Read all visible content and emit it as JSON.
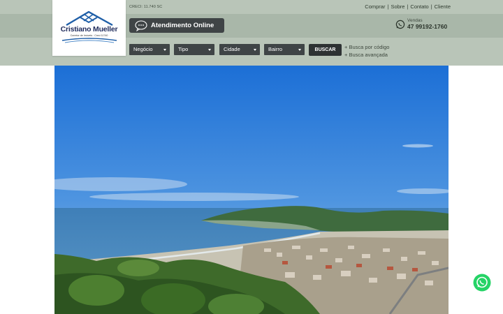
{
  "header": {
    "creci": "CRECI: 11.740 SC",
    "links": [
      "Comprar",
      "Sobre",
      "Contato",
      "Cliente"
    ],
    "online_label": "Atendimento Online",
    "sales_label": "Vendas",
    "sales_phone": "47 99192-1760"
  },
  "logo": {
    "name": "Cristiano Mueller",
    "subtitle": "Corretor de Imóveis · Creci 11740"
  },
  "search": {
    "selects": [
      "Negócio",
      "Tipo",
      "Cidade",
      "Bairro"
    ],
    "button": "BUSCAR",
    "code_link": "+ Busca por código",
    "advanced_link": "+ Busca avançada"
  },
  "icons": {
    "logo": "house-roof-logo-icon",
    "chat": "chat-bubbles-icon",
    "whatsapp": "whatsapp-icon"
  },
  "colors": {
    "header_light": "#b9c5b8",
    "header_dark": "#a9b7a9",
    "control_bg": "#3f4446",
    "logo_blue": "#1f2b5b",
    "whatsapp_green": "#25d366"
  }
}
